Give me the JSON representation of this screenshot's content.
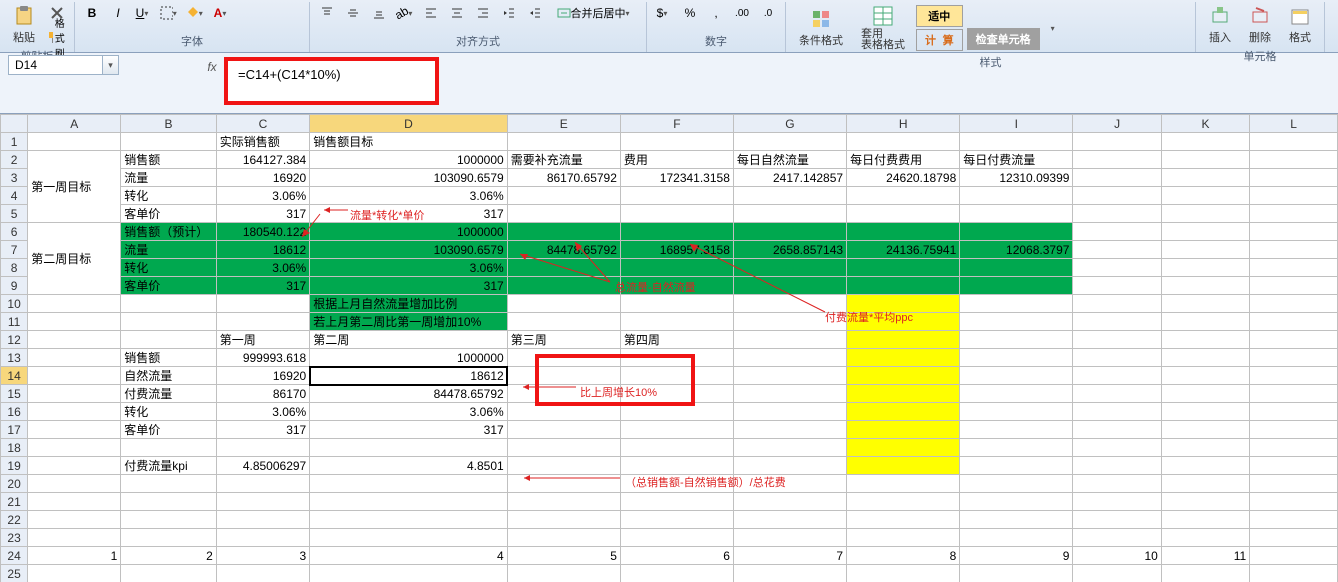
{
  "ribbon": {
    "clipboard": {
      "paste": "粘贴",
      "brush": "格式刷",
      "label": "剪贴板"
    },
    "font": {
      "label": "字体"
    },
    "align": {
      "merge": "合并后居中",
      "label": "对齐方式"
    },
    "number": {
      "label": "数字"
    },
    "styles": {
      "cond_fmt": "条件格式",
      "table_fmt": "套用\n表格格式",
      "normal": "适中",
      "normal_sub": "适中",
      "calc": "计 算",
      "calc_sub": "计算",
      "check_btn": "检查单元格",
      "label": "样式"
    },
    "cells": {
      "insert": "插入",
      "delete": "删除",
      "format": "格式",
      "label": "单元格"
    }
  },
  "formula_bar": {
    "cell_ref": "D14",
    "fx": "fx",
    "formula": "=C14+(C14*10%)"
  },
  "columns": [
    "A",
    "B",
    "C",
    "D",
    "E",
    "F",
    "G",
    "H",
    "I",
    "J",
    "K",
    "L"
  ],
  "rows": {
    "r1": {
      "C": "实际销售额",
      "D": "销售额目标"
    },
    "r2": {
      "B": "销售额",
      "C": "164127.384",
      "D": "1000000",
      "E": "需要补充流量",
      "F": "费用",
      "G": "每日自然流量",
      "H": "每日付费费用",
      "I": "每日付费流量"
    },
    "r3": {
      "A": "第一周目标",
      "B": "流量",
      "C": "16920",
      "D": "103090.6579",
      "E": "86170.65792",
      "F": "172341.3158",
      "G": "2417.142857",
      "H": "24620.18798",
      "I": "12310.09399"
    },
    "r4": {
      "B": "转化",
      "C": "3.06%",
      "D": "3.06%"
    },
    "r5": {
      "B": "客单价",
      "C": "317",
      "D": "317"
    },
    "r6": {
      "B": "销售额（预计）",
      "C": "180540.122",
      "D": "1000000"
    },
    "r7": {
      "A": "第二周目标",
      "B": "流量",
      "C": "18612",
      "D": "103090.6579",
      "E": "84478.65792",
      "F": "168957.3158",
      "G": "2658.857143",
      "H": "24136.75941",
      "I": "12068.3797"
    },
    "r8": {
      "B": "转化",
      "C": "3.06%",
      "D": "3.06%"
    },
    "r9": {
      "B": "客单价",
      "C": "317",
      "D": "317"
    },
    "r10": {
      "D": "根据上月自然流量增加比例"
    },
    "r11": {
      "D": "若上月第二周比第一周增加10%"
    },
    "r12": {
      "C": "第一周",
      "D": "第二周",
      "E": "第三周",
      "F": "第四周"
    },
    "r13": {
      "B": "销售额",
      "C": "999993.618",
      "D": "1000000"
    },
    "r14": {
      "B": "自然流量",
      "C": "16920",
      "D": "18612"
    },
    "r15": {
      "B": "付费流量",
      "C": "86170",
      "D": "84478.65792"
    },
    "r16": {
      "B": "转化",
      "C": "3.06%",
      "D": "3.06%"
    },
    "r17": {
      "B": "客单价",
      "C": "317",
      "D": "317"
    },
    "r19": {
      "B": "付费流量kpi",
      "C": "4.85006297",
      "D": "4.8501"
    },
    "r24": {
      "A": "1",
      "B": "2",
      "C": "3",
      "D": "4",
      "E": "5",
      "F": "6",
      "G": "7",
      "H": "8",
      "I": "9",
      "J": "10",
      "K": "11"
    }
  },
  "annotations": {
    "a1": "流量*转化*单价",
    "a2": "总流量-自然流量",
    "a3": "付费流量*平均ppc",
    "a4": "比上周增长10%",
    "a5": "（总销售额-自然销售额）/总花费"
  }
}
